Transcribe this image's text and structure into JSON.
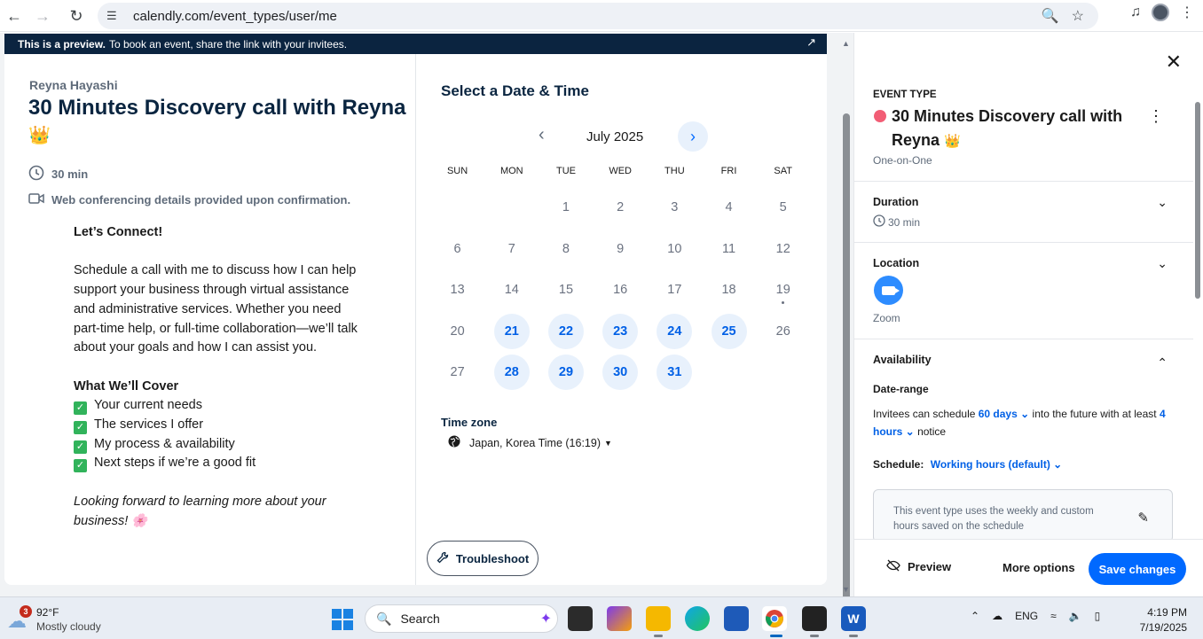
{
  "browser": {
    "url": "calendly.com/event_types/user/me"
  },
  "preview_banner": {
    "bold": "This is a preview.",
    "text": "To book an event, share the link with your invitees."
  },
  "event_page": {
    "host_name": "Reyna Hayashi",
    "title": "30 Minutes Discovery call with Reyna",
    "crown_emoji": "👑",
    "duration": "30 min",
    "conferencing": "Web conferencing details provided upon confirmation.",
    "description": {
      "heading": "Let’s Connect!",
      "paragraph": "Schedule a call with me to discuss how I can help support your business through virtual assistance and administrative services. Whether you need part-time help, or full-time collaboration—we’ll talk about your goals and how I can assist you.",
      "cover_heading": "What We’ll Cover",
      "cover_items": [
        "Your current needs",
        "The services I offer",
        "My process & availability",
        "Next steps if we’re a good fit"
      ],
      "closing": "Looking forward to learning more about your business!",
      "closing_emoji": "🌸"
    }
  },
  "calendar": {
    "heading": "Select a Date & Time",
    "month": "July 2025",
    "weekdays": [
      "SUN",
      "MON",
      "TUE",
      "WED",
      "THU",
      "FRI",
      "SAT"
    ],
    "leading_blanks": 2,
    "days_in_month": 31,
    "available_days": [
      21,
      22,
      23,
      24,
      25,
      28,
      29,
      30,
      31
    ],
    "today": 19,
    "timezone_label": "Time zone",
    "timezone_value": "Japan, Korea Time (16:19)",
    "troubleshoot": "Troubleshoot"
  },
  "panel": {
    "event_type_label": "EVENT TYPE",
    "title": "30 Minutes Discovery call with Reyna",
    "crown_emoji": "👑",
    "event_kind": "One-on-One",
    "accent_color": "#f25d75",
    "duration_title": "Duration",
    "duration_value": "30 min",
    "location_title": "Location",
    "location_value": "Zoom",
    "availability_title": "Availability",
    "date_range_title": "Date-range",
    "invitees_prefix": "Invitees can schedule",
    "days_value": "60 days",
    "invitees_mid": "into the future with at least",
    "hours_value": "4 hours",
    "invitees_suffix": "notice",
    "schedule_label": "Schedule:",
    "schedule_value": "Working hours (default)",
    "notice_text": "This event type uses the weekly and custom hours saved on the schedule",
    "preview_btn": "Preview",
    "more_options_btn": "More options",
    "save_btn": "Save changes",
    "save_color": "#0069ff"
  },
  "taskbar": {
    "weather_badge": "3",
    "temperature": "92°F",
    "condition": "Mostly cloudy",
    "search_placeholder": "Search",
    "language": "ENG",
    "time": "4:19 PM",
    "date": "7/19/2025"
  }
}
